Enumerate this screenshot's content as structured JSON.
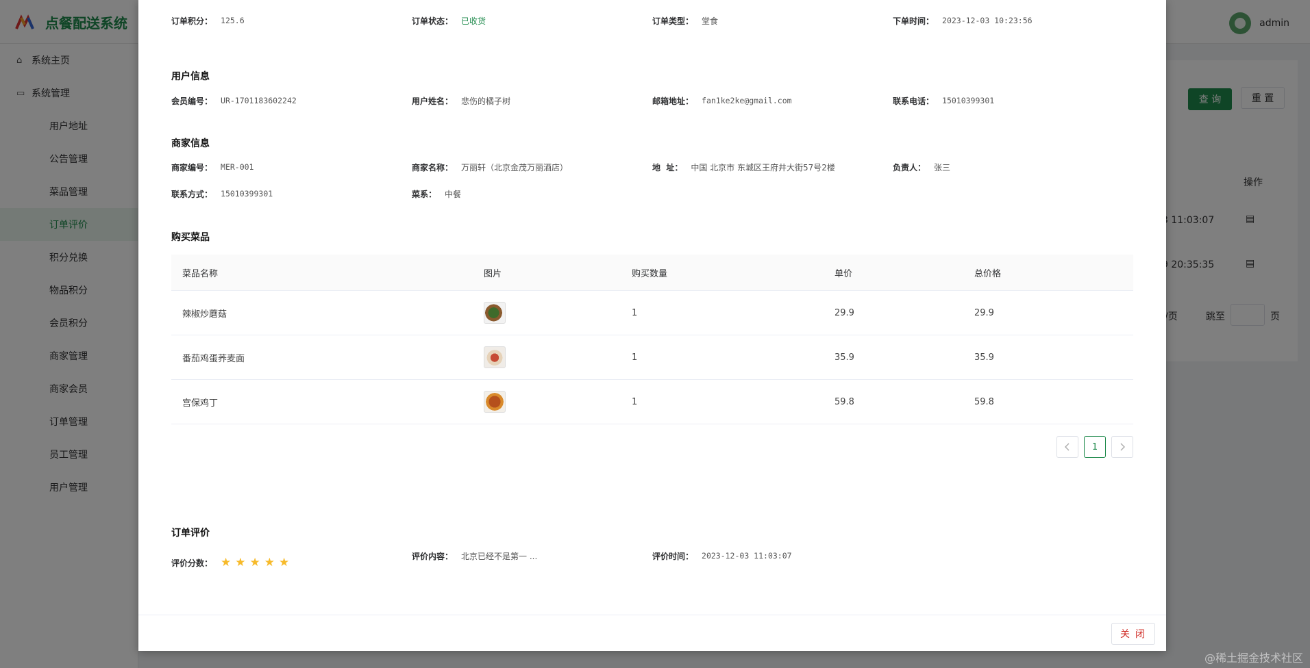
{
  "app": {
    "title": "点餐配送系统",
    "username": "admin",
    "query_label": "查 询",
    "reset_label": "重 置",
    "operation_header": "操作",
    "row_times": [
      "3 11:03:07",
      "9 20:35:35"
    ],
    "page_size_fragment": "/页",
    "goto_label": "跳至",
    "page_suffix": "页"
  },
  "sidebar": {
    "home": "系统主页",
    "manage": "系统管理",
    "items": [
      "用户地址",
      "公告管理",
      "菜品管理",
      "订单评价",
      "积分兑换",
      "物品积分",
      "会员积分",
      "商家管理",
      "商家会员",
      "订单管理",
      "员工管理",
      "用户管理"
    ]
  },
  "order": {
    "points_label": "订单积分：",
    "points": "125.6",
    "status_label": "订单状态：",
    "status": "已收货",
    "type_label": "订单类型：",
    "type": "堂食",
    "time_label": "下单时间：",
    "time": "2023-12-03 10:23:56"
  },
  "user": {
    "section": "用户信息",
    "id_label": "会员编号：",
    "id": "UR-1701183602242",
    "name_label": "用户姓名：",
    "name": "悲伤的橘子树",
    "email_label": "邮箱地址：",
    "email": "fan1ke2ke@gmail.com",
    "phone_label": "联系电话：",
    "phone": "15010399301"
  },
  "merchant": {
    "section": "商家信息",
    "id_label": "商家编号：",
    "id": "MER-001",
    "name_label": "商家名称：",
    "name": "万丽轩（北京金茂万丽酒店）",
    "addr_label": "地  址：",
    "addr": "中国 北京市 东城区王府井大街57号2楼",
    "owner_label": "负责人：",
    "owner": "张三",
    "contact_label": "联系方式：",
    "contact": "15010399301",
    "cuisine_label": "菜系：",
    "cuisine": "中餐"
  },
  "items": {
    "section": "购买菜品",
    "headers": [
      "菜品名称",
      "图片",
      "购买数量",
      "单价",
      "总价格"
    ],
    "rows": [
      {
        "name": "辣椒炒蘑菇",
        "image": "dish-photo-mushroom",
        "qty": "1",
        "price": "29.9",
        "total": "29.9"
      },
      {
        "name": "番茄鸡蛋荞麦面",
        "image": "dish-photo-noodles",
        "qty": "1",
        "price": "35.9",
        "total": "35.9"
      },
      {
        "name": "宫保鸡丁",
        "image": "dish-photo-chicken",
        "qty": "1",
        "price": "59.8",
        "total": "59.8"
      }
    ],
    "page": "1",
    "prev_icon": "chevron-left-icon",
    "next_icon": "chevron-right-icon"
  },
  "review": {
    "section": "订单评价",
    "score_label": "评价分数：",
    "score": 5,
    "max_score": 5,
    "content_label": "评价内容：",
    "content": "北京已经不是第一 ...",
    "time_label": "评价时间：",
    "time": "2023-12-03 11:03:07"
  },
  "footer": {
    "close_label": "关 闭"
  },
  "watermark": "@稀土掘金技术社区",
  "colors": {
    "brand": "#1f8a4c",
    "danger": "#d0302a",
    "star": "#f7ba2a"
  }
}
